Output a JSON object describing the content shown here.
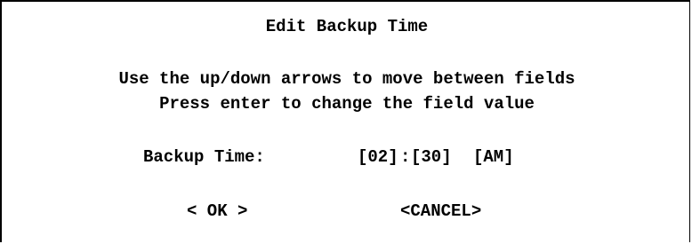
{
  "dialog": {
    "title": "Edit Backup Time",
    "instructions": [
      "Use the up/down arrows to move between fields",
      "Press enter to change the field value"
    ],
    "time_label": "Backup Time:",
    "fields": {
      "hour": "[02]",
      "separator": ":",
      "minute": "[30]",
      "ampm": "[AM]"
    },
    "buttons": {
      "ok": "< OK >",
      "cancel": "<CANCEL>"
    }
  },
  "colors": {
    "background": "#ffffff",
    "text": "#000000",
    "border": "#000000"
  }
}
